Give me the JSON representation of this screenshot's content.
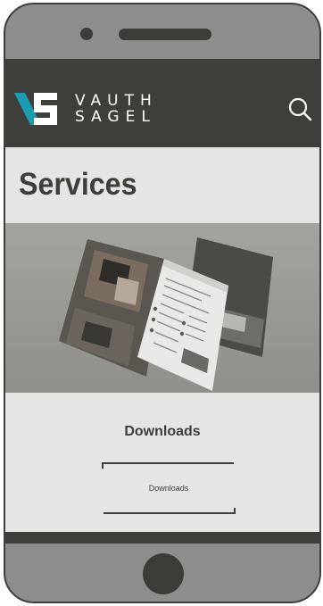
{
  "brand": {
    "line1": "VAUTH",
    "line2": "SAGEL",
    "accent": "#1a9cb0"
  },
  "header": {
    "search_icon": "search-icon"
  },
  "page": {
    "title": "Services"
  },
  "hero": {
    "description_icon": "brochure-image"
  },
  "downloads": {
    "heading": "Downloads",
    "button_label": "Downloads"
  },
  "colors": {
    "dark": "#3e3f3b",
    "light": "#e5e5e5",
    "phone_body": "#8c8e8b"
  }
}
